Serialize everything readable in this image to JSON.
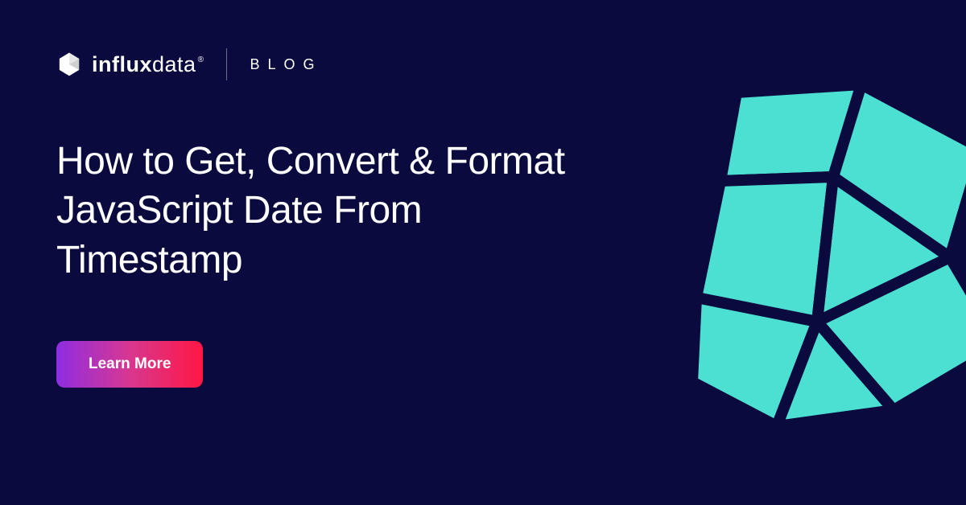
{
  "brand": {
    "name_prefix": "influx",
    "name_suffix": "data",
    "registered_symbol": "®"
  },
  "header": {
    "section_label": "BLOG"
  },
  "headline": "How to Get, Convert & Format JavaScript Date From Timestamp",
  "cta": {
    "label": "Learn More"
  },
  "colors": {
    "background": "#0a0a3e",
    "accent_shape": "#4ce0d2",
    "text": "#ffffff",
    "button_gradient_start": "#8e2de2",
    "button_gradient_end": "#ff1744"
  }
}
